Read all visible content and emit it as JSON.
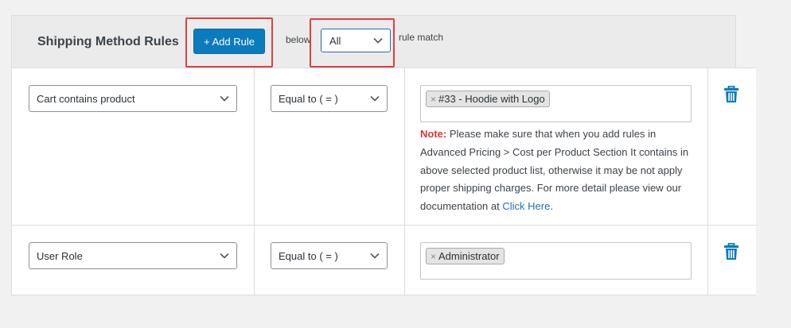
{
  "header": {
    "title": "Shipping Method Rules",
    "add_rule_label": "+ Add Rule",
    "below_label": "below",
    "match_value": "All",
    "rule_match_label": "rule match"
  },
  "rules": [
    {
      "condition": "Cart contains product",
      "operator": "Equal to ( = )",
      "value_tag": "#33 - Hoodie with Logo",
      "note_label": "Note:",
      "note_text": " Please make sure that when you add rules in Advanced Pricing > Cost per Product Section It contains in above selected product list, otherwise it may be not apply proper shipping charges. For more detail please view our documentation at ",
      "note_link": "Click Here",
      "note_end": "."
    },
    {
      "condition": "User Role",
      "operator": "Equal to ( = )",
      "value_tag": "Administrator"
    }
  ],
  "colors": {
    "button": "#0a7bbd",
    "highlight": "#e04040",
    "trash": "#0a7bbd",
    "note_label": "#d63638",
    "link": "#2271b1"
  },
  "icons": {
    "chevron": "chevron-down-icon",
    "delete": "trash-icon",
    "remove_tag": "close-icon"
  }
}
